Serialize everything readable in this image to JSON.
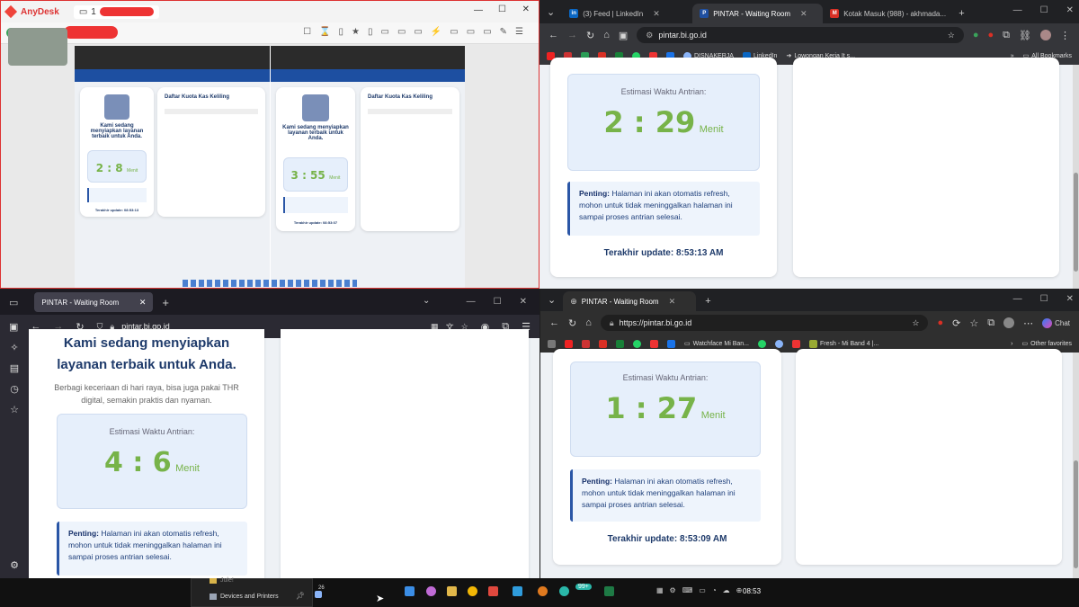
{
  "q1": {
    "app_title": "AnyDesk",
    "session_tab": "1",
    "left_page": {
      "title": "Daftar Kuota Kas Keliling",
      "heading": "Kami sedang menyiapkan layanan terbaik untuk Anda.",
      "time": "2 : 8",
      "unit": "Menit",
      "updated": "Terakhir update: 08:53:13"
    },
    "right_page": {
      "title": "Daftar Kuota Kas Keliling",
      "heading": "Kami sedang menyiapkan layanan terbaik untuk Anda.",
      "time": "3 : 55",
      "unit": "Menit",
      "updated": "Terakhir update: 08:53:07"
    }
  },
  "q2": {
    "tabs": [
      {
        "label": "(3) Feed | LinkedIn",
        "favicon": "in",
        "color": "#0a66c2"
      },
      {
        "label": "PINTAR - Waiting Room",
        "favicon": "P",
        "color": "#1f4fa0"
      },
      {
        "label": "Kotak Masuk (988) - akhmada...",
        "favicon": "M",
        "color": "#d93025"
      }
    ],
    "url": "pintar.bi.go.id",
    "bookmarks": [
      "DISNAKERJA",
      "LinkedIn",
      "Lowongan Kerja It s..."
    ],
    "all_bookmarks": "All Bookmarks",
    "estimasi_label": "Estimasi Waktu Antrian:",
    "time": "2 : 29",
    "unit": "Menit",
    "note_bold": "Penting:",
    "note_text": "Halaman ini akan otomatis refresh, mohon untuk tidak meninggalkan halaman ini sampai proses antrian selesai.",
    "updated": "Terakhir update: 8:53:13 AM"
  },
  "q3": {
    "tab": "PINTAR - Waiting Room",
    "url": "pintar.bi.go.id",
    "heading": "Kami sedang menyiapkan layanan terbaik untuk Anda.",
    "subtext": "Berbagi keceriaan di hari raya, bisa juga pakai THR digital, semakin praktis dan nyaman.",
    "estimasi_label": "Estimasi Waktu Antrian:",
    "time": "4 : 6",
    "unit": "Menit",
    "note_bold": "Penting:",
    "note_text": "Halaman ini akan otomatis refresh, mohon untuk tidak meninggalkan halaman ini sampai proses antrian selesai."
  },
  "q4": {
    "tab": "PINTAR - Waiting Room",
    "url": "https://pintar.bi.go.id",
    "chat": "Chat",
    "bookmarks": [
      "Watchface Mi Ban...",
      "Fresh - Mi Band 4 |..."
    ],
    "other_favorites": "Other favorites",
    "estimasi_label": "Estimasi Waktu Antrian:",
    "time": "1 : 27",
    "unit": "Menit",
    "note_bold": "Penting:",
    "note_text": "Halaman ini akan otomatis refresh, mohon untuk tidak meninggalkan halaman ini sampai proses antrian selesai.",
    "updated": "Terakhir update: 8:53:09 AM"
  },
  "taskbar": {
    "folder": "Jule!",
    "devices": "Devices and Printers",
    "weather": "26",
    "badge": "99+",
    "clock": "08:53"
  }
}
